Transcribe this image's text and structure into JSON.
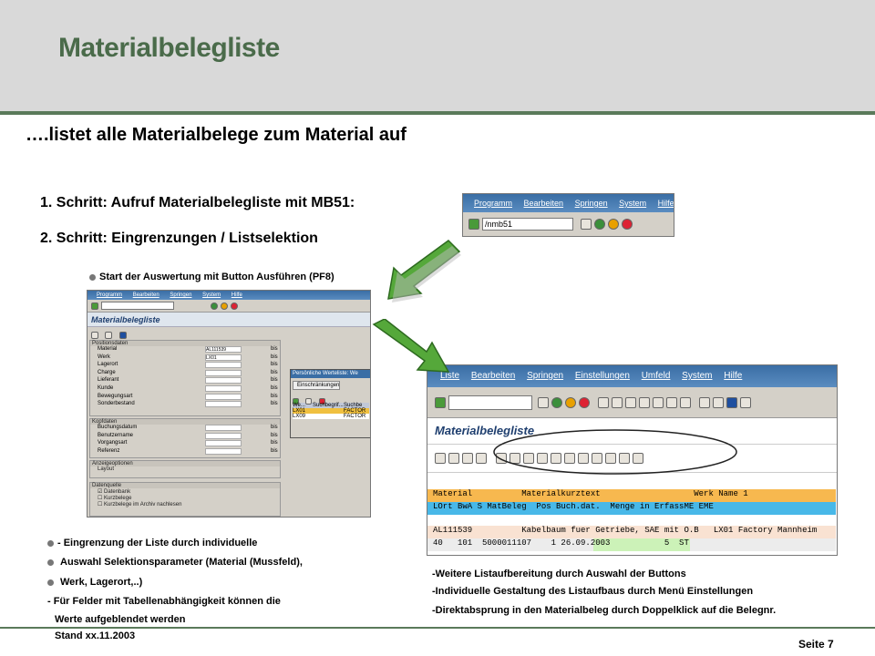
{
  "slide": {
    "title": "Materialbelegliste",
    "subtitle": "….listet alle Materialbelege zum Material auf",
    "step1": "1. Schritt: Aufruf Materialbelegliste mit MB51:",
    "step2": "2. Schritt: Eingrenzungen / Listselektion",
    "note_start": "Start der Auswertung mit Button Ausführen (PF8)",
    "left_bullets": [
      "- Eingrenzung der Liste durch individuelle",
      "Auswahl Selektionsparameter (Material (Mussfeld),",
      "Werk, Lagerort,..)",
      "- Für Felder mit Tabellenabhängigkeit können die",
      "Werte aufgeblendet werden"
    ],
    "right_bullets": [
      "-Weitere Listaufbereitung durch Auswahl der Buttons",
      "-Individuelle Gestaltung des Listaufbaus durch Menü Einstellungen",
      "-Direktabsprung in den Materialbeleg durch Doppelklick auf die Belegnr."
    ],
    "stand": "Stand xx.11.2003",
    "page": "Seite 7"
  },
  "sap_small": {
    "menu": [
      "Programm",
      "Bearbeiten",
      "Springen",
      "System",
      "Hilfe"
    ],
    "command": "/nmb51"
  },
  "sap_selection": {
    "menu": [
      "Programm",
      "Bearbeiten",
      "Springen",
      "System",
      "Hilfe"
    ],
    "title": "Materialbelegliste",
    "sections": {
      "positionsdaten": "Positionsdaten",
      "kopfdaten": "Kopfdaten",
      "anzeigeoptionen": "Anzeigeoptionen",
      "datenquelle": "Datenquelle"
    },
    "pos_rows": [
      {
        "label": "Material",
        "value": "AL111539",
        "bis": "bis"
      },
      {
        "label": "Werk",
        "value": "LX01",
        "bis": "bis"
      },
      {
        "label": "Lagerort",
        "value": "",
        "bis": "bis"
      },
      {
        "label": "Charge",
        "value": "",
        "bis": "bis"
      },
      {
        "label": "Lieferant",
        "value": "",
        "bis": "bis"
      },
      {
        "label": "Kunde",
        "value": "",
        "bis": "bis"
      },
      {
        "label": "Bewegungsart",
        "value": "",
        "bis": "bis"
      },
      {
        "label": "Sonderbestand",
        "value": "",
        "bis": "bis"
      }
    ],
    "kopf_rows": [
      {
        "label": "Buchungsdatum",
        "bis": "bis"
      },
      {
        "label": "Benutzername",
        "bis": "bis"
      },
      {
        "label": "Vorgangsart",
        "bis": "bis"
      },
      {
        "label": "Referenz",
        "bis": "bis"
      }
    ],
    "layout_label": "Layout",
    "datenquelle_rows": [
      "Datenbank",
      "Kurzbelege",
      "Kurzbelege im Archiv nachlesen"
    ],
    "popup": {
      "title": "Persönliche Werteliste: We",
      "tab": "Einschränkungen",
      "col1": "We...",
      "col2": "Suchbegrif...",
      "col3": "Suchbe",
      "rows": [
        {
          "c1": "LX01",
          "c3": "FACTOR",
          "selected": true
        },
        {
          "c1": "LX09",
          "c3": "FACTOR",
          "selected": false
        }
      ]
    }
  },
  "sap_list": {
    "menu": [
      "Liste",
      "Bearbeiten",
      "Springen",
      "Einstellungen",
      "Umfeld",
      "System",
      "Hilfe"
    ],
    "title": "Materialbelegliste",
    "header1": "Material          Materialkurztext                   Werk Name 1",
    "header2": "LOrt BwA S MatBeleg  Pos Buch.dat.  Menge in ErfassME EME",
    "row1": "AL111539          Kabelbaum fuer Getriebe, SAE mit O.B   LX01 Factory Mannheim",
    "row2": "40   101  5000011107    1 26.09.2003           5  ST",
    "colors": {
      "header1": "#f7b84f",
      "header2": "#48b8e8",
      "row1": "#f9e2d2",
      "row2": "#ececec",
      "highlight": "#ccf2b8"
    }
  }
}
